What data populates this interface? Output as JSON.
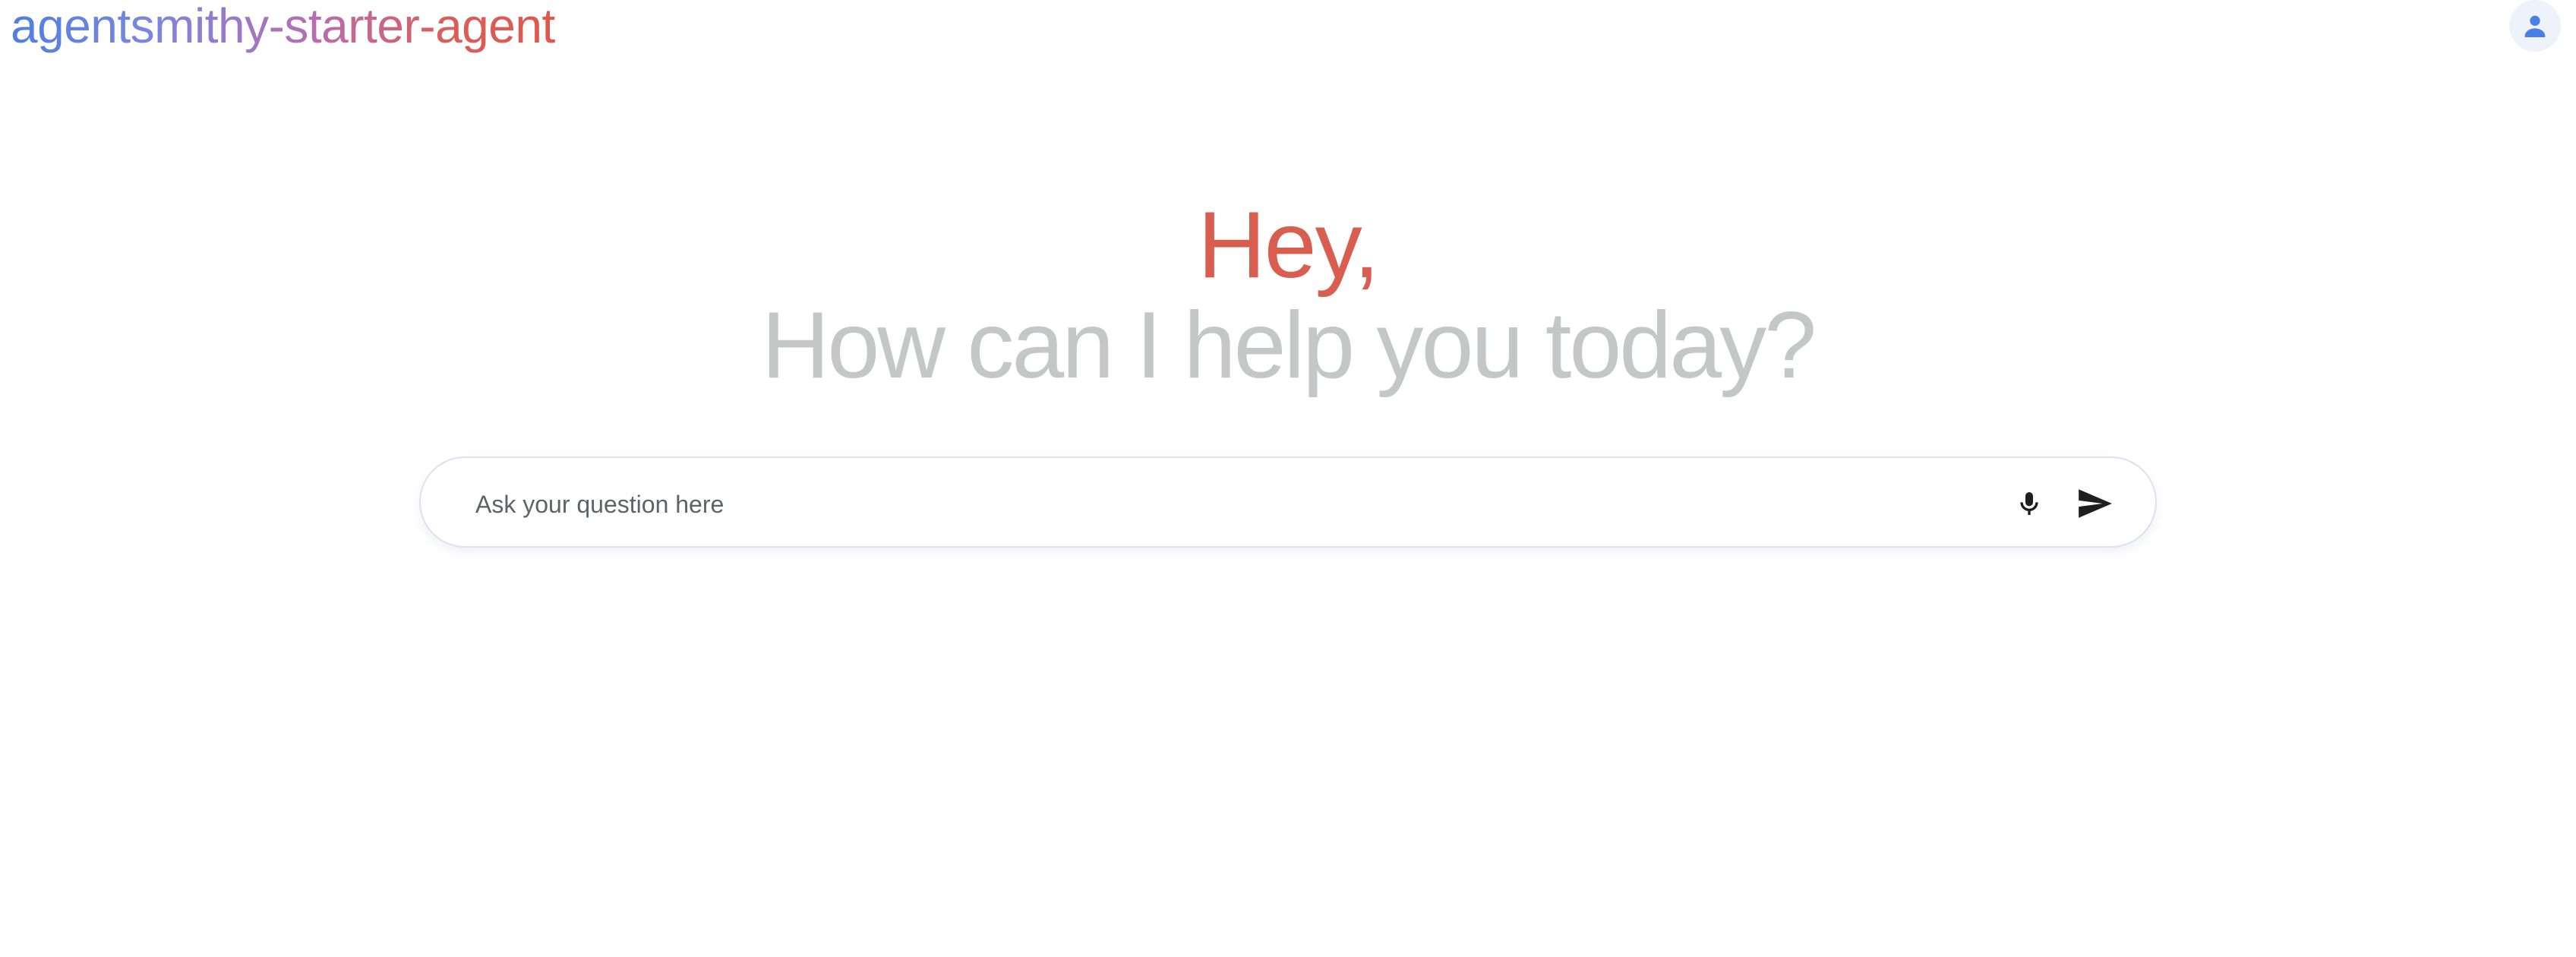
{
  "header": {
    "app_title": "agentsmithy-starter-agent",
    "account_icon": "person-icon"
  },
  "greeting": {
    "hey": "Hey,",
    "subtitle": "How can I help you today?"
  },
  "prompt": {
    "placeholder": "Ask your question here",
    "value": "",
    "mic_icon": "microphone-icon",
    "send_icon": "send-icon"
  },
  "colors": {
    "title_gradient_start": "#4f7fe0",
    "title_gradient_end": "#e0574c",
    "hey": "#da5e4f",
    "subtitle": "#c4c7c5",
    "account_bg": "#eef2fb",
    "account_icon": "#4a7fe6",
    "input_border": "#dbe2f3"
  }
}
